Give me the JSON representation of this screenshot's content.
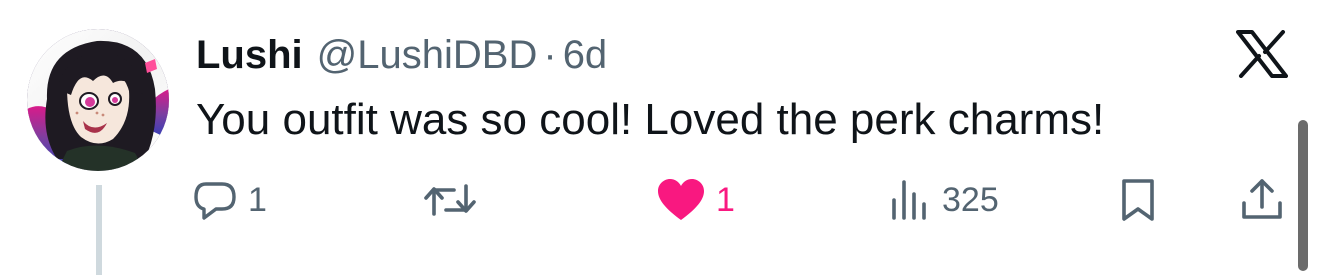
{
  "post": {
    "author_name": "Lushi",
    "author_handle": "@LushiDBD",
    "separator": "·",
    "time_ago": "6d",
    "text": "You outfit was so cool! Loved the perk charms!"
  },
  "actions": {
    "reply": {
      "icon": "reply-icon",
      "count": "1"
    },
    "retweet": {
      "icon": "retweet-icon",
      "count": ""
    },
    "like": {
      "icon": "heart-icon",
      "count": "1",
      "liked": true,
      "color": "#f91880"
    },
    "views": {
      "icon": "views-icon",
      "count": "325"
    },
    "bookmark": {
      "icon": "bookmark-icon"
    },
    "share": {
      "icon": "share-icon"
    }
  },
  "colors": {
    "text_primary": "#0f1419",
    "text_secondary": "#536471",
    "like_active": "#f91880",
    "thread_line": "#cfd9de"
  }
}
